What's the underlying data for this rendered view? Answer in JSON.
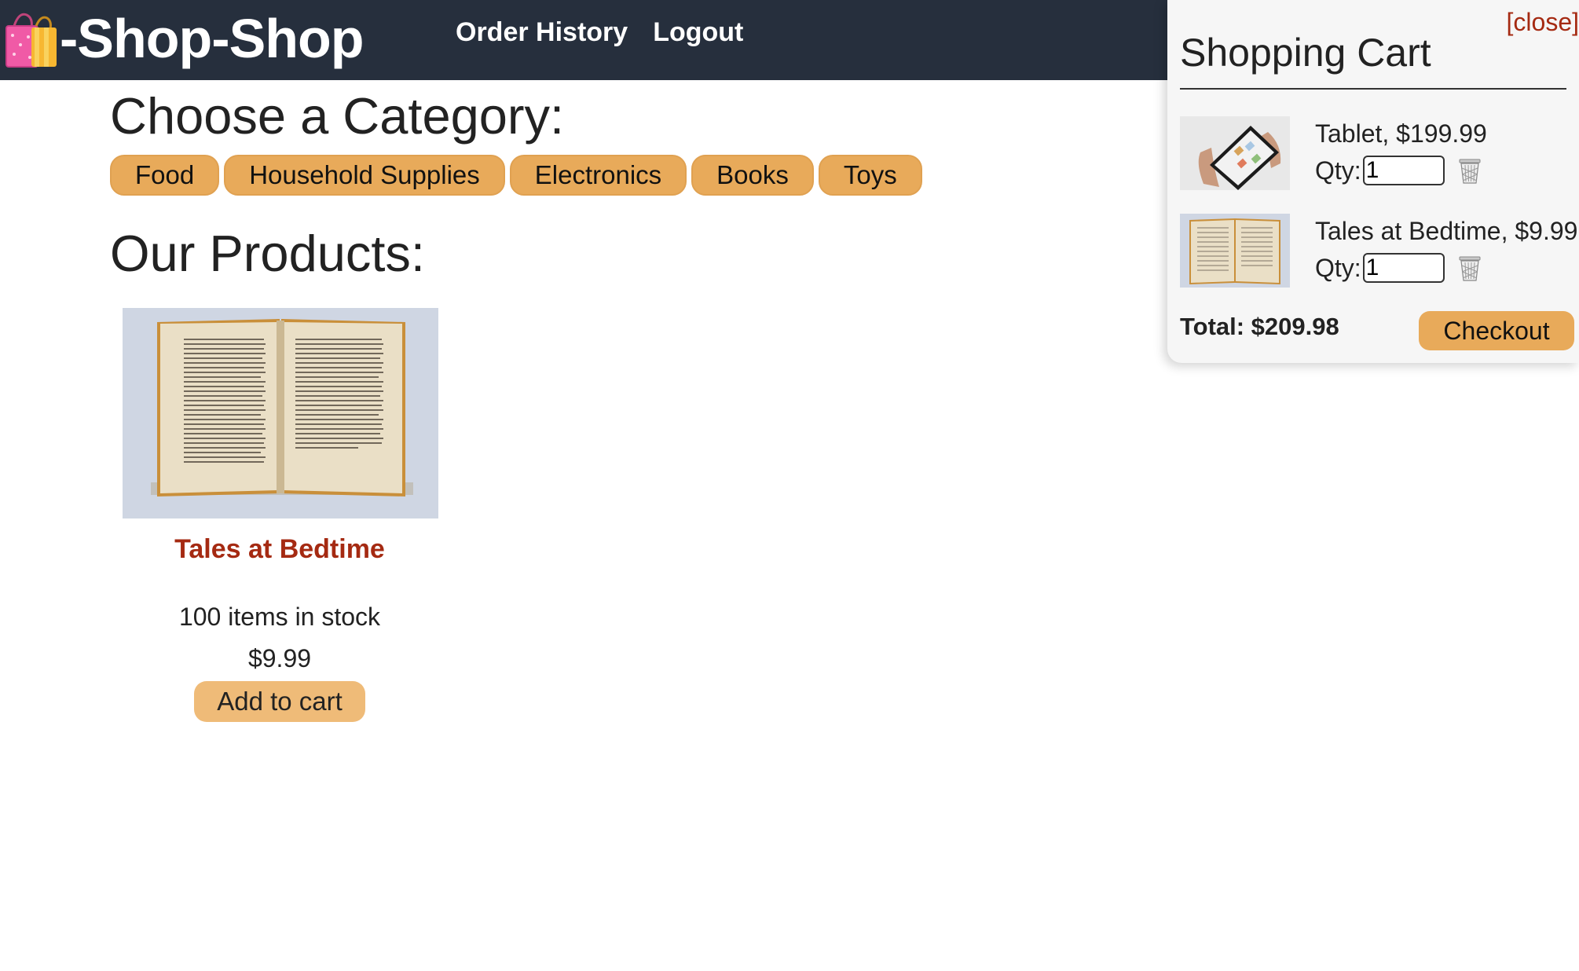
{
  "header": {
    "brand": "-Shop-Shop",
    "brand_icon": "shopping-bags-icon",
    "nav": {
      "order_history": "Order History",
      "logout": "Logout"
    }
  },
  "main": {
    "categories_title": "Choose a Category:",
    "categories": [
      "Food",
      "Household Supplies",
      "Electronics",
      "Books",
      "Toys"
    ],
    "products_title": "Our Products:",
    "products": [
      {
        "name": "Tales at Bedtime",
        "stock": "100 items in stock",
        "price": "$9.99",
        "add_label": "Add to cart"
      }
    ]
  },
  "cart": {
    "close_label": "[close]",
    "title": "Shopping Cart",
    "items": [
      {
        "label": "Tablet, $199.99",
        "qty_label": "Qty:",
        "qty": "1"
      },
      {
        "label": "Tales at Bedtime, $9.99",
        "qty_label": "Qty:",
        "qty": "1"
      }
    ],
    "total": "Total: $209.98",
    "checkout_label": "Checkout"
  },
  "colors": {
    "header_bg": "#262f3d",
    "button_orange": "#e8aa5a",
    "link_red": "#a52a12"
  }
}
